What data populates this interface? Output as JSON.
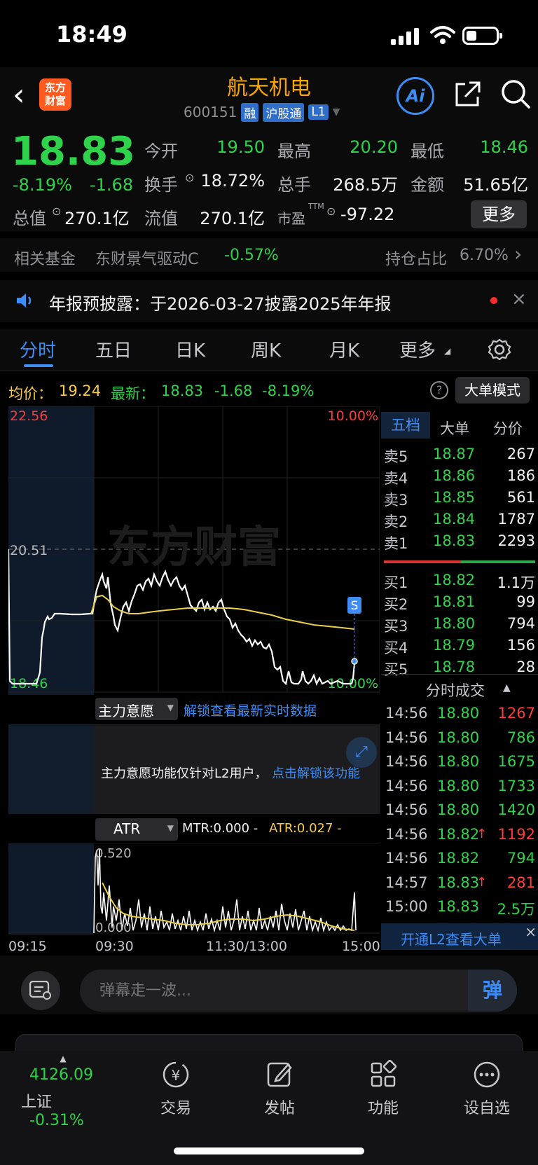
{
  "status": {
    "time": "18:49"
  },
  "header": {
    "logo_line1": "东方",
    "logo_line2": "财富",
    "name": "航天机电",
    "code": "600151",
    "tags": [
      "融",
      "沪股通",
      "L1"
    ],
    "ai_label": "Ai"
  },
  "quote": {
    "price": "18.83",
    "change_pct": "-8.19%",
    "change_amt": "-1.68",
    "fields": {
      "open_label": "今开",
      "open": "19.50",
      "high_label": "最高",
      "high": "20.20",
      "low_label": "最低",
      "low": "18.46",
      "turnover_label": "换手",
      "turnover": "18.72%",
      "volume_label": "总手",
      "volume": "268.5万",
      "amount_label": "金额",
      "amount": "51.65亿",
      "mktcap_label": "总值",
      "mktcap": "270.1亿",
      "float_label": "流值",
      "float": "270.1亿",
      "pe_label": "市盈",
      "pe_sup": "TTM",
      "pe": "-97.22"
    },
    "more_label": "更多"
  },
  "fund": {
    "label": "相关基金",
    "name": "东财景气驱动C",
    "change": "-0.57%",
    "hold_label": "持仓占比",
    "hold_value": "6.70%"
  },
  "announcement": {
    "text": "年报预披露：于2026-03-27披露2025年年报"
  },
  "tabs": [
    "分时",
    "五日",
    "日K",
    "周K",
    "月K",
    "更多"
  ],
  "info": {
    "avg_label": "均价：",
    "avg": "19.24",
    "latest_label": "最新：",
    "latest": "18.83",
    "latest_chg": "-1.68",
    "latest_pct": "-8.19%",
    "help": "?",
    "mode_label": "大单模式"
  },
  "chart": {
    "y_top": "22.56",
    "y_mid": "20.51",
    "y_bottom": "18.46",
    "pct_top": "10.00%",
    "pct_bottom": "10.00%",
    "watermark": "东方财富",
    "marker": "S",
    "main_force_label": "主力意愿",
    "unlock_link": "解锁查看最新实时数据",
    "l2_notice": "主力意愿功能仅针对L2用户，",
    "l2_link": "点击解锁该功能",
    "atr_label": "ATR",
    "mtr_text": "MTR:0.000 -",
    "atr_text": "ATR:0.027 -",
    "atr_top": "0.520",
    "atr_bottom": "0.000",
    "x_labels": [
      "09:15",
      "09:30",
      "11:30/13:00",
      "15:00"
    ]
  },
  "chart_data": {
    "type": "line",
    "x": [
      "09:15",
      "09:30",
      "11:30/13:00",
      "15:00"
    ],
    "ylim": [
      18.46,
      22.56
    ],
    "series": [],
    "reference": 20.51
  },
  "depth": {
    "tabs": [
      "五档",
      "大单",
      "分价"
    ],
    "asks": [
      {
        "label": "卖5",
        "price": "18.87",
        "vol": "267"
      },
      {
        "label": "卖4",
        "price": "18.86",
        "vol": "186"
      },
      {
        "label": "卖3",
        "price": "18.85",
        "vol": "561"
      },
      {
        "label": "卖2",
        "price": "18.84",
        "vol": "1787"
      },
      {
        "label": "卖1",
        "price": "18.83",
        "vol": "2293"
      }
    ],
    "bids": [
      {
        "label": "买1",
        "price": "18.82",
        "vol": "1.1万"
      },
      {
        "label": "买2",
        "price": "18.81",
        "vol": "99"
      },
      {
        "label": "买3",
        "price": "18.80",
        "vol": "794"
      },
      {
        "label": "买4",
        "price": "18.79",
        "vol": "156"
      },
      {
        "label": "买5",
        "price": "18.78",
        "vol": "28"
      }
    ],
    "trades_title": "分时成交",
    "trades": [
      {
        "t": "14:56",
        "p": "18.80",
        "v": "1267",
        "c": "red",
        "up": ""
      },
      {
        "t": "14:56",
        "p": "18.80",
        "v": "786",
        "c": "green",
        "up": ""
      },
      {
        "t": "14:56",
        "p": "18.80",
        "v": "1675",
        "c": "green",
        "up": ""
      },
      {
        "t": "14:56",
        "p": "18.80",
        "v": "1733",
        "c": "green",
        "up": ""
      },
      {
        "t": "14:56",
        "p": "18.80",
        "v": "1420",
        "c": "green",
        "up": ""
      },
      {
        "t": "14:56",
        "p": "18.82",
        "v": "1192",
        "c": "red",
        "up": "↑"
      },
      {
        "t": "14:56",
        "p": "18.82",
        "v": "794",
        "c": "green",
        "up": ""
      },
      {
        "t": "14:57",
        "p": "18.83",
        "v": "281",
        "c": "red",
        "up": "↑"
      },
      {
        "t": "15:00",
        "p": "18.83",
        "v": "2.5万",
        "c": "green",
        "up": ""
      }
    ],
    "l2_banner": "开通L2查看大单"
  },
  "comment": {
    "placeholder": "弹幕走一波...",
    "send_label": "弹"
  },
  "tabbar": {
    "index_value": "4126.09",
    "index_name": "上证",
    "index_change": "-0.31%",
    "items": [
      "交易",
      "发帖",
      "功能",
      "设自选"
    ]
  }
}
